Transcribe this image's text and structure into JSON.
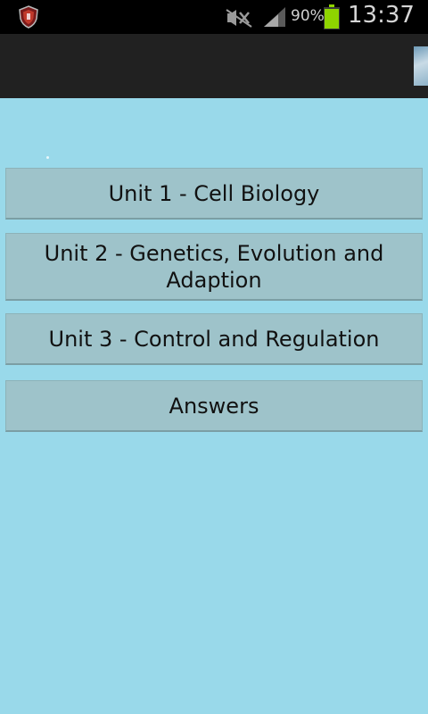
{
  "status_bar": {
    "battery_percent": "90%",
    "battery_level": 0.9,
    "time": "13:37",
    "icons": [
      "shield-notification-icon",
      "mute-icon",
      "signal-icon",
      "battery-icon"
    ]
  },
  "colors": {
    "content_background": "#99d9ea",
    "button_background": "#9ec3ca",
    "action_bar": "#212121",
    "battery_fill": "#8fd400"
  },
  "menu": {
    "items": [
      {
        "label": "Unit 1 - Cell Biology"
      },
      {
        "label": "Unit 2 - Genetics, Evolution and Adaption"
      },
      {
        "label": "Unit 3 - Control and Regulation"
      },
      {
        "label": "Answers"
      }
    ]
  }
}
